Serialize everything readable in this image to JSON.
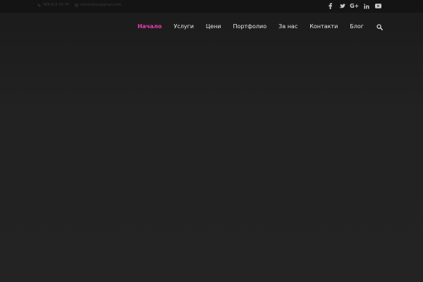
{
  "topbar": {
    "phone": "089 613 50 74",
    "email": "marenthax@gmail.com",
    "socials": [
      {
        "icon": "facebook-icon"
      },
      {
        "icon": "twitter-icon"
      },
      {
        "icon": "google-plus-icon",
        "text": "G+"
      },
      {
        "icon": "linkedin-icon"
      },
      {
        "icon": "youtube-icon"
      }
    ]
  },
  "nav": {
    "items": [
      {
        "label": "Начало",
        "active": true
      },
      {
        "label": "Услуги"
      },
      {
        "label": "Цени"
      },
      {
        "label": "Портфолио"
      },
      {
        "label": "За нас"
      },
      {
        "label": "Контакти"
      },
      {
        "label": "Блог"
      }
    ],
    "search_icon": "search-icon"
  },
  "colors": {
    "accent": "#e83fae",
    "nav_text": "#e8e8e8",
    "topbar_bg": "#141414",
    "page_bg": "#232323"
  }
}
